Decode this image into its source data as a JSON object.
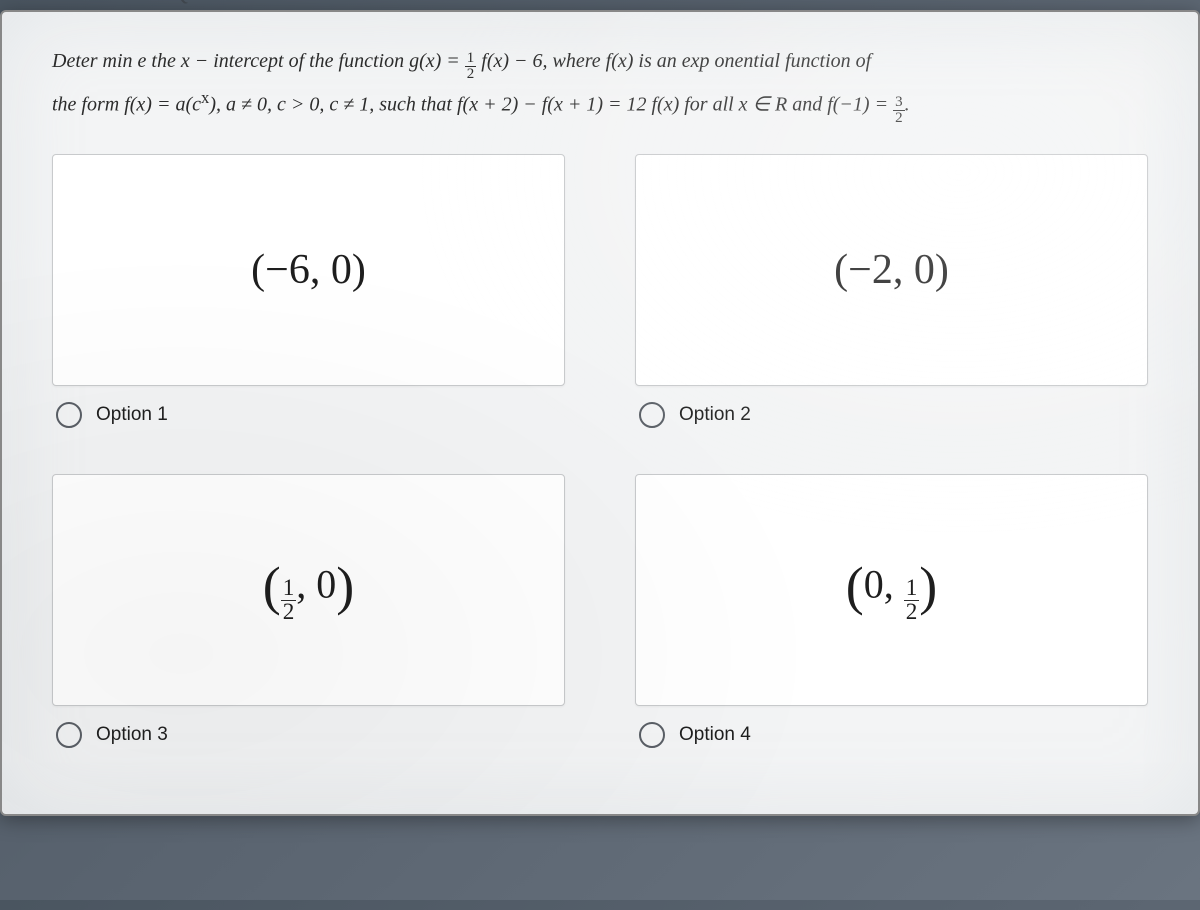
{
  "page_tag": "Q1",
  "question": {
    "line1_pre": "Deter min e the x − intercept of the function g(x) = ",
    "line1_frac_top": "1",
    "line1_frac_bot": "2",
    "line1_mid": " f(x) − 6, where f(x) is an exp onential function of",
    "line2_pre": "the form f(x) = a(c",
    "line2_sup": "x",
    "line2_mid": "), a ≠ 0, c > 0, c ≠ 1, such that f(x + 2) − f(x + 1) = 12 f(x) for all x ∈ R and f(−1) = ",
    "line2_frac_top": "3",
    "line2_frac_bot": "2",
    "line2_end": "."
  },
  "options": {
    "opt1": {
      "label": "Option 1",
      "math": "(−6, 0)"
    },
    "opt2": {
      "label": "Option 2",
      "math": "(−2, 0)"
    },
    "opt3": {
      "label": "Option 3",
      "open": "(",
      "frac_top": "1",
      "frac_bot": "2",
      "after_frac": ", 0",
      "close": ")"
    },
    "opt4": {
      "label": "Option 4",
      "open": "(",
      "before_frac": "0, ",
      "frac_top": "1",
      "frac_bot": "2",
      "close": ")"
    }
  }
}
